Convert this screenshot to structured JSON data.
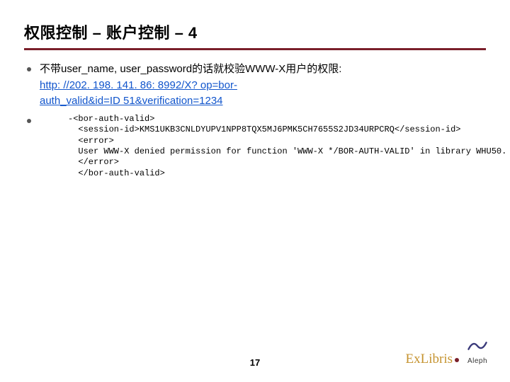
{
  "title": "权限控制 – 账户控制 – 4",
  "bullets": {
    "b1_prefix": "不带user_name, user_password的话就校验WWW-X用户的权限:",
    "b1_link_line1": "http: //202. 198. 141. 86: 8992/X? op=bor-",
    "b1_link_line2": "auth_valid&id=ID 51&verification=1234",
    "b1_link_href": "http://202.198.141.86:8992/X?op=bor-auth_valid&id=ID51&verification=1234",
    "b2_empty": ""
  },
  "code": "-<bor-auth-valid>\n  <session-id>KMS1UKB3CNLDYUPV1NPP8TQX5MJ6PMK5CH7655S2JD34URPCRQ</session-id>\n  <error>\n  User WWW-X denied permission for function 'WWW-X */BOR-AUTH-VALID' in library WHU50.\n  </error>\n  </bor-auth-valid>",
  "footer": {
    "page": "17",
    "brand_main": "ExLibris",
    "brand_sub": "Aleph"
  }
}
